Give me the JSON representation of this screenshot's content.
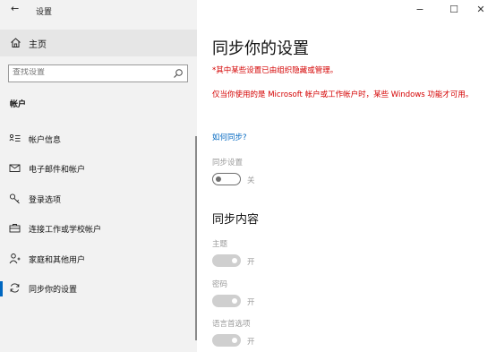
{
  "window": {
    "back_glyph": "←",
    "title": "设置",
    "minimize_glyph": "−",
    "maximize_glyph": "☐",
    "close_glyph": "✕"
  },
  "sidebar": {
    "home_label": "主页",
    "search_placeholder": "查找设置",
    "section_header": "帐户",
    "items": [
      {
        "label": "帐户信息",
        "icon": "account-info-icon"
      },
      {
        "label": "电子邮件和帐户",
        "icon": "mail-icon"
      },
      {
        "label": "登录选项",
        "icon": "key-icon"
      },
      {
        "label": "连接工作或学校帐户",
        "icon": "briefcase-icon"
      },
      {
        "label": "家庭和其他用户",
        "icon": "add-person-icon"
      },
      {
        "label": "同步你的设置",
        "icon": "sync-icon",
        "active": true
      }
    ]
  },
  "main": {
    "title": "同步你的设置",
    "managed_note": "*其中某些设置已由组织隐藏或管理。",
    "warning_note": "仅当你使用的是 Microsoft 帐户或工作帐户时，某些 Windows 功能才可用。",
    "how_link": "如何同步?",
    "sync_setting": {
      "label": "同步设置",
      "state_label": "关",
      "on": false
    },
    "content_title": "同步内容",
    "content_items": [
      {
        "label": "主题",
        "state_label": "开",
        "on": true
      },
      {
        "label": "密码",
        "state_label": "开",
        "on": true
      },
      {
        "label": "语言首选项",
        "state_label": "开",
        "on": true
      }
    ]
  },
  "colors": {
    "accent": "#0067c0",
    "warning": "#d40000"
  }
}
